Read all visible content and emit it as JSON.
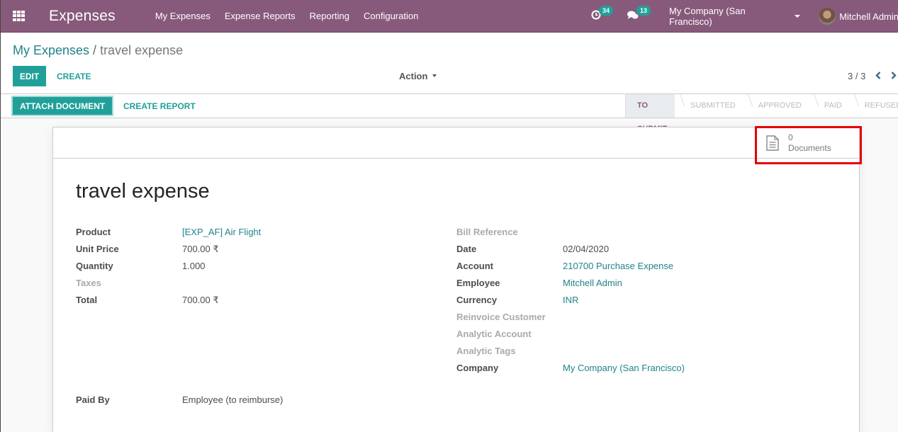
{
  "navbar": {
    "app_title": "Expenses",
    "menu": [
      "My Expenses",
      "Expense Reports",
      "Reporting",
      "Configuration"
    ],
    "activity_count": "34",
    "message_count": "13",
    "company": "My Company (San Francisco)",
    "user": "Mitchell Admin",
    "brand_color": "#875a7b"
  },
  "control_panel": {
    "breadcrumb": {
      "parent": "My Expenses",
      "separator": "/",
      "current": "travel expense"
    },
    "edit_label": "EDIT",
    "create_label": "CREATE",
    "action_label": "Action",
    "pager": "3 / 3",
    "pager_prev": "‹",
    "pager_next": "›"
  },
  "statusbar": {
    "attach_label": "ATTACH DOCUMENT",
    "create_report_label": "CREATE REPORT",
    "stages": [
      {
        "label": "TO SUBMIT",
        "active": true
      },
      {
        "label": "SUBMITTED",
        "active": false
      },
      {
        "label": "APPROVED",
        "active": false
      },
      {
        "label": "PAID",
        "active": false
      },
      {
        "label": "REFUSED",
        "active": false
      }
    ]
  },
  "sheet": {
    "stat_button": {
      "count": "0",
      "label": "Documents"
    },
    "title": "travel expense",
    "left_fields": [
      {
        "label": "Product",
        "value": "[EXP_AF] Air Flight",
        "link": true,
        "muted": false
      },
      {
        "label": "Unit Price",
        "value": "700.00 ₹",
        "link": false,
        "muted": false
      },
      {
        "label": "Quantity",
        "value": "1.000",
        "link": false,
        "muted": false
      },
      {
        "label": "Taxes",
        "value": "",
        "link": false,
        "muted": true
      },
      {
        "label": "Total",
        "value": "700.00 ₹",
        "link": false,
        "muted": false
      }
    ],
    "right_fields": [
      {
        "label": "Bill Reference",
        "value": "",
        "link": false,
        "muted": true
      },
      {
        "label": "Date",
        "value": "02/04/2020",
        "link": false,
        "muted": false
      },
      {
        "label": "Account",
        "value": "210700 Purchase Expense",
        "link": true,
        "muted": false
      },
      {
        "label": "Employee",
        "value": "Mitchell Admin",
        "link": true,
        "muted": false
      },
      {
        "label": "Currency",
        "value": "INR",
        "link": true,
        "muted": false
      },
      {
        "label": "Reinvoice Customer",
        "value": "",
        "link": false,
        "muted": true
      },
      {
        "label": "Analytic Account",
        "value": "",
        "link": false,
        "muted": true
      },
      {
        "label": "Analytic Tags",
        "value": "",
        "link": false,
        "muted": true
      },
      {
        "label": "Company",
        "value": "My Company (San Francisco)",
        "link": true,
        "muted": false
      }
    ],
    "bottom_fields": [
      {
        "label": "Paid By",
        "value": "Employee (to reimburse)",
        "link": false,
        "muted": false
      }
    ]
  },
  "colors": {
    "accent": "#21a09a",
    "link": "#21838a",
    "highlight": "#e60000"
  }
}
